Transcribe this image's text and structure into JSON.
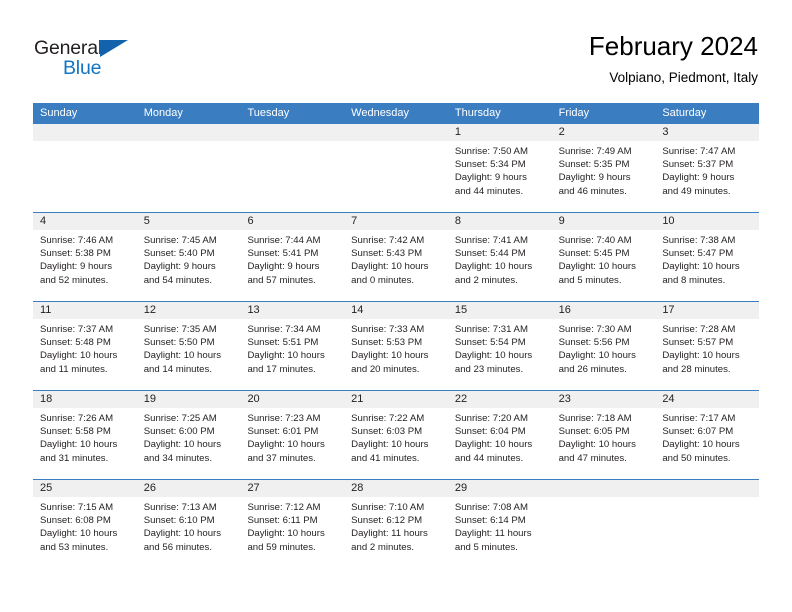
{
  "brand": {
    "name_part1": "General",
    "name_part2": "Blue",
    "triangle_color": "#1263ac",
    "blue_color": "#1275c4"
  },
  "header": {
    "title": "February 2024",
    "subtitle": "Volpiano, Piedmont, Italy"
  },
  "theme": {
    "header_blue": "#3a7dc0",
    "number_band": "#f0f0f0",
    "text": "#231f20"
  },
  "weekdays": [
    "Sunday",
    "Monday",
    "Tuesday",
    "Wednesday",
    "Thursday",
    "Friday",
    "Saturday"
  ],
  "weeks": [
    {
      "numbers": [
        "",
        "",
        "",
        "",
        "1",
        "2",
        "3"
      ],
      "cells": [
        {
          "lines": []
        },
        {
          "lines": []
        },
        {
          "lines": []
        },
        {
          "lines": []
        },
        {
          "lines": [
            "Sunrise: 7:50 AM",
            "Sunset: 5:34 PM",
            "Daylight: 9 hours",
            "and 44 minutes."
          ]
        },
        {
          "lines": [
            "Sunrise: 7:49 AM",
            "Sunset: 5:35 PM",
            "Daylight: 9 hours",
            "and 46 minutes."
          ]
        },
        {
          "lines": [
            "Sunrise: 7:47 AM",
            "Sunset: 5:37 PM",
            "Daylight: 9 hours",
            "and 49 minutes."
          ]
        }
      ]
    },
    {
      "numbers": [
        "4",
        "5",
        "6",
        "7",
        "8",
        "9",
        "10"
      ],
      "cells": [
        {
          "lines": [
            "Sunrise: 7:46 AM",
            "Sunset: 5:38 PM",
            "Daylight: 9 hours",
            "and 52 minutes."
          ]
        },
        {
          "lines": [
            "Sunrise: 7:45 AM",
            "Sunset: 5:40 PM",
            "Daylight: 9 hours",
            "and 54 minutes."
          ]
        },
        {
          "lines": [
            "Sunrise: 7:44 AM",
            "Sunset: 5:41 PM",
            "Daylight: 9 hours",
            "and 57 minutes."
          ]
        },
        {
          "lines": [
            "Sunrise: 7:42 AM",
            "Sunset: 5:43 PM",
            "Daylight: 10 hours",
            "and 0 minutes."
          ]
        },
        {
          "lines": [
            "Sunrise: 7:41 AM",
            "Sunset: 5:44 PM",
            "Daylight: 10 hours",
            "and 2 minutes."
          ]
        },
        {
          "lines": [
            "Sunrise: 7:40 AM",
            "Sunset: 5:45 PM",
            "Daylight: 10 hours",
            "and 5 minutes."
          ]
        },
        {
          "lines": [
            "Sunrise: 7:38 AM",
            "Sunset: 5:47 PM",
            "Daylight: 10 hours",
            "and 8 minutes."
          ]
        }
      ]
    },
    {
      "numbers": [
        "11",
        "12",
        "13",
        "14",
        "15",
        "16",
        "17"
      ],
      "cells": [
        {
          "lines": [
            "Sunrise: 7:37 AM",
            "Sunset: 5:48 PM",
            "Daylight: 10 hours",
            "and 11 minutes."
          ]
        },
        {
          "lines": [
            "Sunrise: 7:35 AM",
            "Sunset: 5:50 PM",
            "Daylight: 10 hours",
            "and 14 minutes."
          ]
        },
        {
          "lines": [
            "Sunrise: 7:34 AM",
            "Sunset: 5:51 PM",
            "Daylight: 10 hours",
            "and 17 minutes."
          ]
        },
        {
          "lines": [
            "Sunrise: 7:33 AM",
            "Sunset: 5:53 PM",
            "Daylight: 10 hours",
            "and 20 minutes."
          ]
        },
        {
          "lines": [
            "Sunrise: 7:31 AM",
            "Sunset: 5:54 PM",
            "Daylight: 10 hours",
            "and 23 minutes."
          ]
        },
        {
          "lines": [
            "Sunrise: 7:30 AM",
            "Sunset: 5:56 PM",
            "Daylight: 10 hours",
            "and 26 minutes."
          ]
        },
        {
          "lines": [
            "Sunrise: 7:28 AM",
            "Sunset: 5:57 PM",
            "Daylight: 10 hours",
            "and 28 minutes."
          ]
        }
      ]
    },
    {
      "numbers": [
        "18",
        "19",
        "20",
        "21",
        "22",
        "23",
        "24"
      ],
      "cells": [
        {
          "lines": [
            "Sunrise: 7:26 AM",
            "Sunset: 5:58 PM",
            "Daylight: 10 hours",
            "and 31 minutes."
          ]
        },
        {
          "lines": [
            "Sunrise: 7:25 AM",
            "Sunset: 6:00 PM",
            "Daylight: 10 hours",
            "and 34 minutes."
          ]
        },
        {
          "lines": [
            "Sunrise: 7:23 AM",
            "Sunset: 6:01 PM",
            "Daylight: 10 hours",
            "and 37 minutes."
          ]
        },
        {
          "lines": [
            "Sunrise: 7:22 AM",
            "Sunset: 6:03 PM",
            "Daylight: 10 hours",
            "and 41 minutes."
          ]
        },
        {
          "lines": [
            "Sunrise: 7:20 AM",
            "Sunset: 6:04 PM",
            "Daylight: 10 hours",
            "and 44 minutes."
          ]
        },
        {
          "lines": [
            "Sunrise: 7:18 AM",
            "Sunset: 6:05 PM",
            "Daylight: 10 hours",
            "and 47 minutes."
          ]
        },
        {
          "lines": [
            "Sunrise: 7:17 AM",
            "Sunset: 6:07 PM",
            "Daylight: 10 hours",
            "and 50 minutes."
          ]
        }
      ]
    },
    {
      "numbers": [
        "25",
        "26",
        "27",
        "28",
        "29",
        "",
        ""
      ],
      "cells": [
        {
          "lines": [
            "Sunrise: 7:15 AM",
            "Sunset: 6:08 PM",
            "Daylight: 10 hours",
            "and 53 minutes."
          ]
        },
        {
          "lines": [
            "Sunrise: 7:13 AM",
            "Sunset: 6:10 PM",
            "Daylight: 10 hours",
            "and 56 minutes."
          ]
        },
        {
          "lines": [
            "Sunrise: 7:12 AM",
            "Sunset: 6:11 PM",
            "Daylight: 10 hours",
            "and 59 minutes."
          ]
        },
        {
          "lines": [
            "Sunrise: 7:10 AM",
            "Sunset: 6:12 PM",
            "Daylight: 11 hours",
            "and 2 minutes."
          ]
        },
        {
          "lines": [
            "Sunrise: 7:08 AM",
            "Sunset: 6:14 PM",
            "Daylight: 11 hours",
            "and 5 minutes."
          ]
        },
        {
          "lines": []
        },
        {
          "lines": []
        }
      ]
    }
  ]
}
